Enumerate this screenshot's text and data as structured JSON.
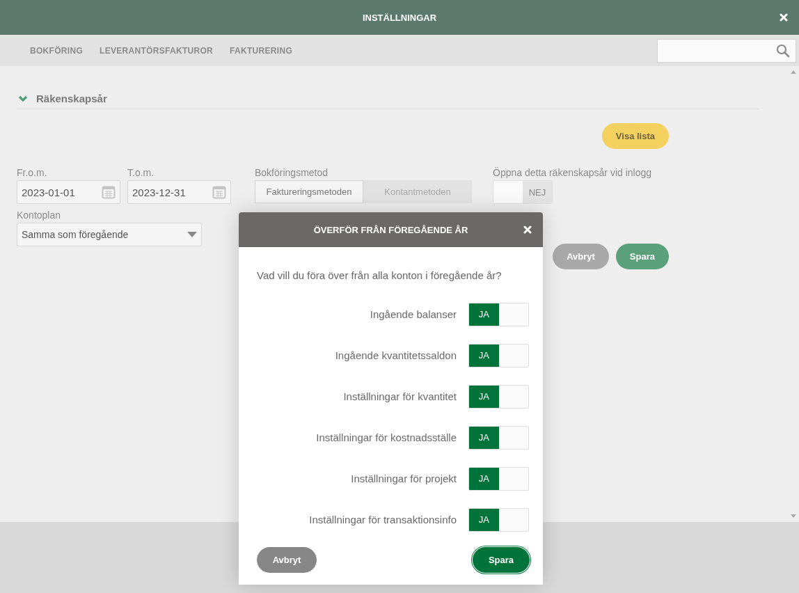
{
  "window": {
    "title": "INSTÄLLNINGAR"
  },
  "tabs": [
    {
      "label": "BOKFÖRING",
      "selected": false
    },
    {
      "label": "LEVERANTÖRSFAKTUROR",
      "selected": false
    },
    {
      "label": "FAKTURERING",
      "selected": false
    }
  ],
  "section": {
    "title": "Räkenskapsår",
    "expanded": true
  },
  "show_list_button": "Visa lista",
  "from": {
    "label": "Fr.o.m.",
    "value": "2023-01-01"
  },
  "to": {
    "label": "T.o.m.",
    "value": "2023-12-31"
  },
  "method": {
    "label": "Bokföringsmetod",
    "options": [
      {
        "label": "Faktureringsmetoden",
        "selected": true
      },
      {
        "label": "Kontantmetoden",
        "selected": false
      }
    ]
  },
  "open_on_login": {
    "label": "Öppna detta räkenskapsår vid inlogg",
    "on": false,
    "state_label": "NEJ"
  },
  "chart_of_accounts": {
    "label": "Kontoplan",
    "value": "Samma som föregående"
  },
  "page_buttons": {
    "cancel": "Avbryt",
    "save": "Spara"
  },
  "dialog": {
    "title": "ÖVERFÖR FRÅN FÖREGÅENDE ÅR",
    "question": "Vad vill du föra över från alla konton i föregående år?",
    "toggles": [
      {
        "label": "Ingående balanser",
        "on": true,
        "state_label": "JA"
      },
      {
        "label": "Ingående kvantitetssaldon",
        "on": true,
        "state_label": "JA"
      },
      {
        "label": "Inställningar för kvantitet",
        "on": true,
        "state_label": "JA"
      },
      {
        "label": "Inställningar för kostnadsställe",
        "on": true,
        "state_label": "JA"
      },
      {
        "label": "Inställningar för projekt",
        "on": true,
        "state_label": "JA"
      },
      {
        "label": "Inställningar för transaktionsinfo",
        "on": true,
        "state_label": "JA"
      }
    ],
    "cancel": "Avbryt",
    "save": "Spara"
  }
}
